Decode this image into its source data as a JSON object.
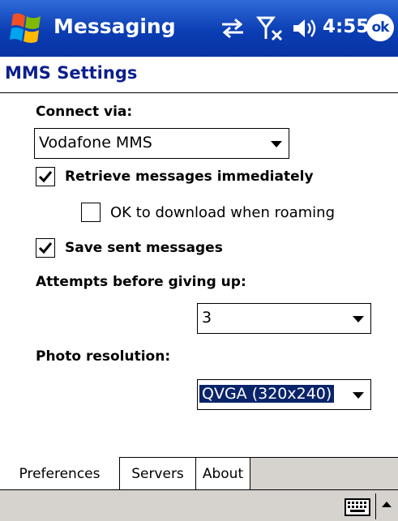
{
  "titlebar": {
    "app_title": "Messaging",
    "clock": "4:55",
    "ok_label": "ok"
  },
  "page": {
    "title": "MMS Settings"
  },
  "form": {
    "connect_via_label": "Connect via:",
    "connect_via_value": "Vodafone MMS",
    "retrieve_immediately_label": "Retrieve messages immediately",
    "retrieve_immediately_checked": true,
    "roaming_label": "OK to download when roaming",
    "roaming_checked": false,
    "save_sent_label": "Save sent messages",
    "save_sent_checked": true,
    "attempts_label": "Attempts before giving up:",
    "attempts_value": "3",
    "photo_label": "Photo resolution:",
    "photo_value": "QVGA (320x240)"
  },
  "tabs": [
    {
      "label": "Preferences",
      "active": true
    },
    {
      "label": "Servers",
      "active": false
    },
    {
      "label": "About",
      "active": false
    }
  ],
  "colors": {
    "titlebar": "#0b3db3",
    "page_title": "#0b1f8c",
    "selection": "#0a246a",
    "menubar": "#d6d3ce"
  },
  "icons": {
    "start": "windows-flag-icon",
    "connectivity": "sync-arrows-icon",
    "signal": "no-signal-icon",
    "volume": "speaker-icon",
    "keyboard": "keyboard-icon",
    "sip": "chevron-up-icon"
  }
}
